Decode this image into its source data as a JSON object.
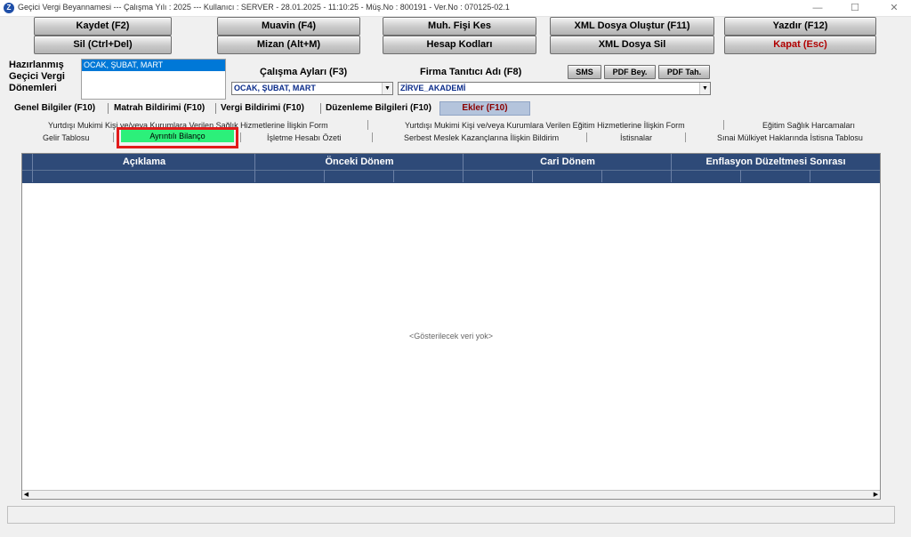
{
  "window": {
    "title": "Geçici Vergi Beyannamesi  ---  Çalışma Yılı : 2025  ---  Kullanıcı : SERVER - 28.01.2025 - 11:10:25 - Müş.No : 800191 - Ver.No : 070125-02.1",
    "icon": "app-logo-icon",
    "minimize": "—",
    "maximize": "☐",
    "close": "✕"
  },
  "toolbar": {
    "kaydet": "Kaydet (F2)",
    "sil": "Sil (Ctrl+Del)",
    "muavin": "Muavin (F4)",
    "mizan": "Mizan (Alt+M)",
    "muh_fisi": "Muh. Fişi Kes",
    "hesap_kodlari": "Hesap Kodları",
    "xml_olustur": "XML Dosya Oluştur (F11)",
    "xml_sil": "XML Dosya Sil",
    "yazdir": "Yazdır (F12)",
    "kapat": "Kapat (Esc)"
  },
  "form": {
    "hazirlanmis_label_1": "Hazırlanmış",
    "hazirlanmis_label_2": "Geçici Vergi",
    "hazirlanmis_label_3": "Dönemleri",
    "donemler_selected": "OCAK, ŞUBAT, MART",
    "calisma_aylari_label": "Çalışma Ayları (F3)",
    "calisma_aylari_value": "OCAK, ŞUBAT, MART",
    "firma_label": "Firma Tanıtıcı Adı (F8)",
    "firma_value": "ZİRVE_AKADEMİ",
    "sms": "SMS",
    "pdf_bey": "PDF Bey.",
    "pdf_tah": "PDF Tah."
  },
  "main_tabs": [
    {
      "label": "Genel Bilgiler (F10)"
    },
    {
      "label": "Matrah Bildirimi (F10)"
    },
    {
      "label": "Vergi Bildirimi (F10)"
    },
    {
      "label": "Düzenleme Bilgileri  (F10)"
    },
    {
      "label": "Ekler (F10)"
    }
  ],
  "sub_tabs_row1": [
    "Yurtdışı Mukimi Kişi ve/veya Kurumlara Verilen Sağlık Hizmetlerine İlişkin Form",
    "Yurtdışı Mukimi Kişi ve/veya Kurumlara Verilen Eğitim Hizmetlerine İlişkin Form",
    "Eğitim Sağlık Harcamaları"
  ],
  "sub_tabs_row2": [
    "Gelir Tablosu",
    "Ayrıntılı Bilanço",
    "İşletme Hesabı Özeti",
    "Serbest Meslek Kazançlarına İlişkin Bildirim",
    "İstisnalar",
    "Sınai Mülkiyet Haklarında İstisna Tablosu"
  ],
  "grid": {
    "columns": [
      "Açıklama",
      "Önceki Dönem",
      "Cari Dönem",
      "Enflasyon Düzeltmesi Sonrası"
    ],
    "empty_message": "<Gösterilecek veri yok>",
    "header_color": "#2e4a78"
  },
  "colors": {
    "highlight_border": "#e21b1b",
    "selected_tab": "#2cf07a",
    "ekler_tab": "#b4c4dc"
  }
}
